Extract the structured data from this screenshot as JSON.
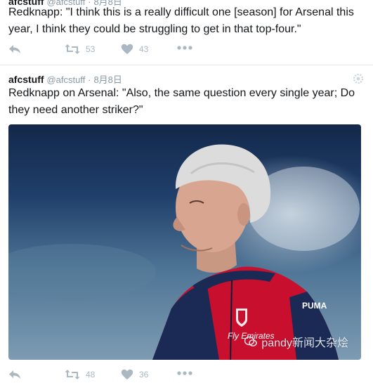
{
  "tweet1": {
    "header": {
      "author": "afcstuff",
      "handle": "@afcstuff",
      "dot": "·",
      "date": "8月8日"
    },
    "text": "Redknapp: \"I think this is a really difficult one [season] for Arsenal this year, I think they could be struggling to get in that top-four.\"",
    "actions": {
      "reply": "reply-icon",
      "retweet_count": "53",
      "like_count": "43",
      "more": "more-icon"
    }
  },
  "tweet2": {
    "header": {
      "author": "afcstuff",
      "handle": "@afcstuff",
      "dot": "·",
      "date": "8月8日"
    },
    "text": "Redknapp on Arsenal: \"Also, the same question every single year; Do they need another striker?\"",
    "photo": {
      "jersey_badge_text": "Fly Emirates",
      "brand": "PUMA"
    },
    "watermark": "pandy新闻大杂烩",
    "actions": {
      "reply": "reply-icon",
      "retweet_count": "48",
      "like_count": "36",
      "more": "more-icon"
    }
  },
  "colors": {
    "text": "#14171a",
    "muted": "#8899a6",
    "icon": "#aab8c2",
    "divider": "#e1e8ed",
    "jersey_red": "#c8102e",
    "jersey_navy": "#1b2a55"
  }
}
